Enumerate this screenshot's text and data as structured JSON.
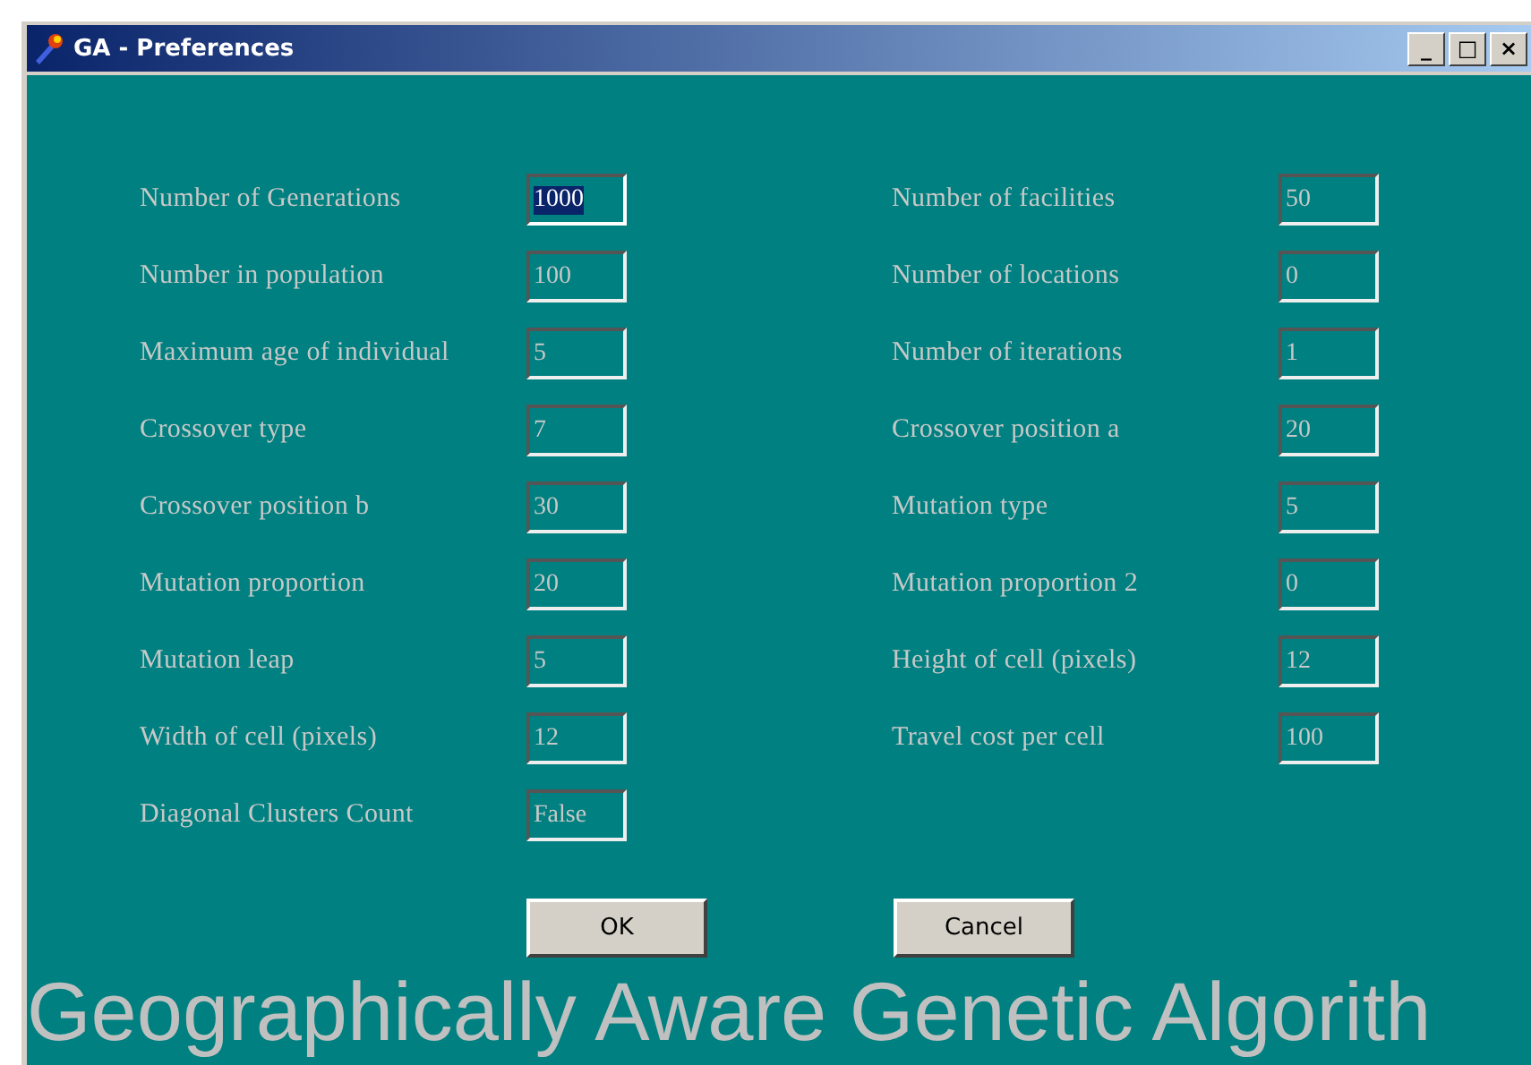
{
  "window": {
    "title": "GA - Preferences",
    "controls": [
      "_",
      "□",
      "×"
    ]
  },
  "left_column": [
    {
      "label": "Number of Generations",
      "value": "1000",
      "focused": true
    },
    {
      "label": "Number in population",
      "value": "100",
      "focused": false
    },
    {
      "label": "Maximum age of individual",
      "value": "5",
      "focused": false
    },
    {
      "label": "Crossover type",
      "value": "7",
      "focused": false
    },
    {
      "label": "Crossover position b",
      "value": "30",
      "focused": false
    },
    {
      "label": "Mutation proportion",
      "value": "20",
      "focused": false
    },
    {
      "label": "Mutation leap",
      "value": "5",
      "focused": false
    },
    {
      "label": "Width of cell (pixels)",
      "value": "12",
      "focused": false
    },
    {
      "label": "Diagonal Clusters Count",
      "value": "False",
      "focused": false
    }
  ],
  "right_column": [
    {
      "label": "Number of facilities",
      "value": "50",
      "focused": false
    },
    {
      "label": "Number of locations",
      "value": "0",
      "focused": false
    },
    {
      "label": "Number of iterations",
      "value": "1",
      "focused": false
    },
    {
      "label": "Crossover position a",
      "value": "20",
      "focused": false
    },
    {
      "label": "Mutation type",
      "value": "5",
      "focused": false
    },
    {
      "label": "Mutation proportion 2",
      "value": "0",
      "focused": false
    },
    {
      "label": "Height of cell (pixels)",
      "value": "12",
      "focused": false
    },
    {
      "label": "Travel cost per cell",
      "value": "100",
      "focused": false
    }
  ],
  "buttons": [
    "OK",
    "Cancel"
  ],
  "banner": "Geographically Aware Genetic Algorith"
}
